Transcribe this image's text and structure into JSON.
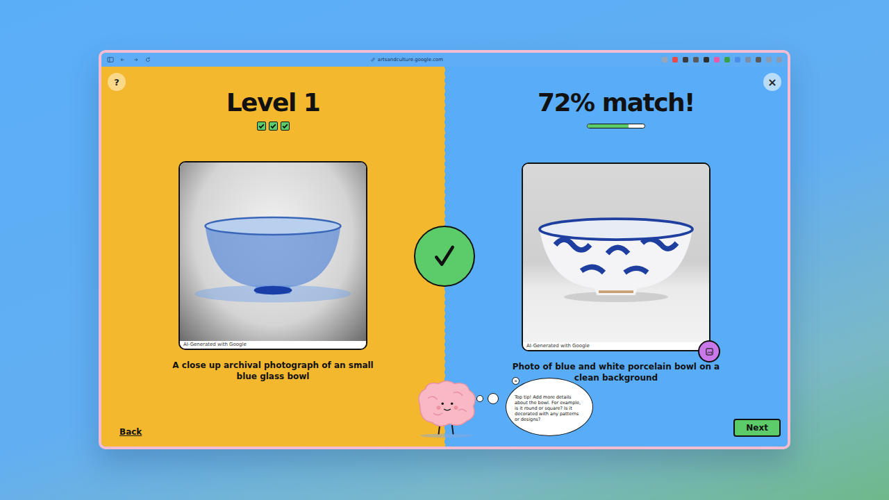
{
  "browser": {
    "url": "artsandculture.google.com"
  },
  "help_button": "?",
  "close_button": "×",
  "target": {
    "title": "Level 1",
    "checks": [
      {
        "checked": true
      },
      {
        "checked": true
      },
      {
        "checked": true
      }
    ],
    "image_label": "AI-Generated with Google",
    "prompt": "A close up archival photograph of an small blue glass bowl"
  },
  "result": {
    "title": "72% match!",
    "level": 0.72,
    "image_label": "AI-Generated with Google",
    "prompt": "Photo of blue and white porcelain bowl on a clean background"
  },
  "verdict": {
    "correct": true
  },
  "tip": {
    "text": "Top tip! Add more details about the bowl. For example, is it round or square? Is it decorated with any patterns or designs?",
    "close": "×"
  },
  "buttons": {
    "back": "Back",
    "next": "Next"
  }
}
